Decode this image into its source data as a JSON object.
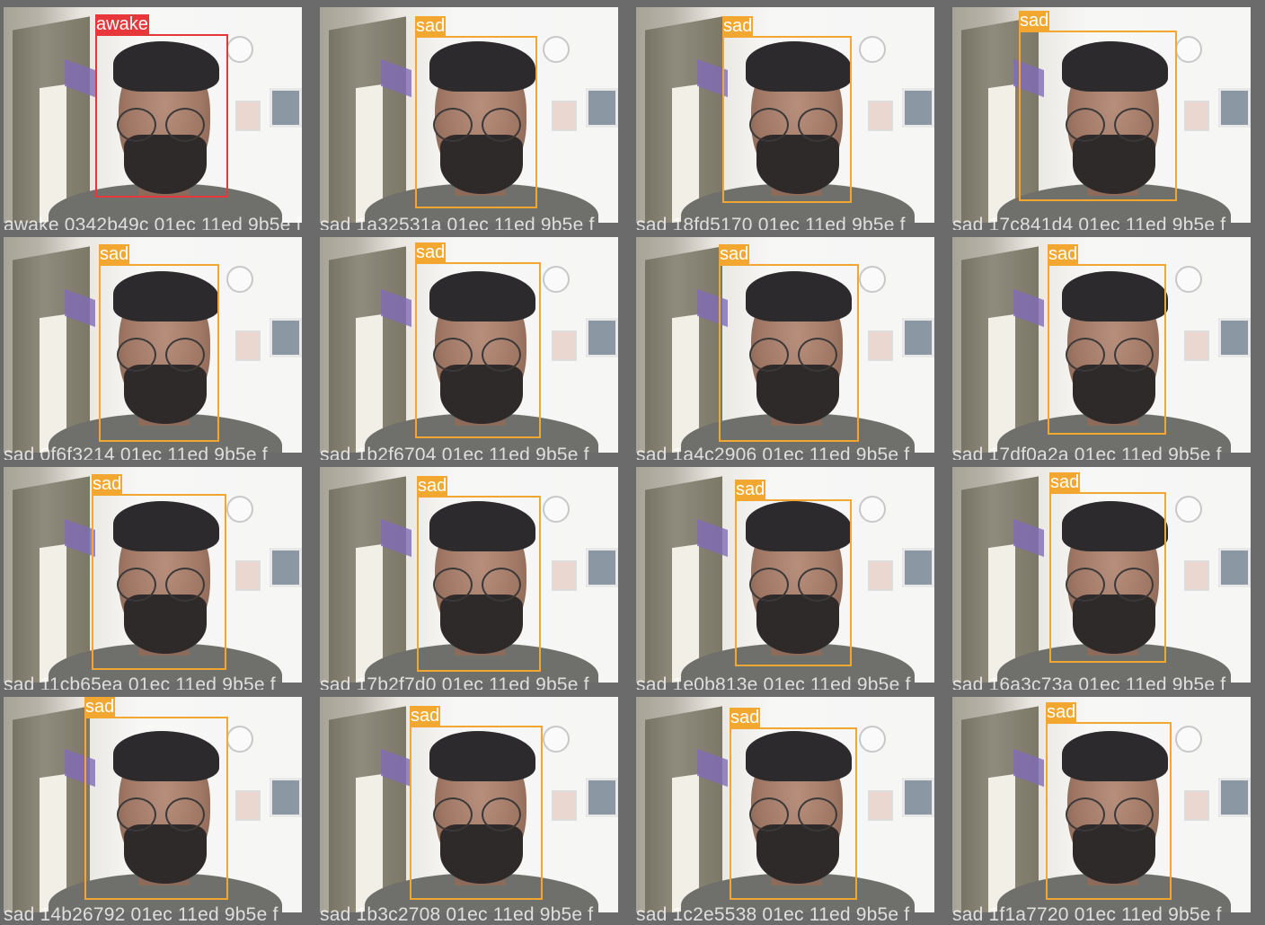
{
  "colors": {
    "awake": "#e8373b",
    "sad": "#f2a830"
  },
  "tiles": [
    {
      "label": "awake",
      "caption": "awake 0342b49c 01ec 11ed 9b5e f"
    },
    {
      "label": "sad",
      "caption": "sad 1a32531a 01ec 11ed 9b5e f"
    },
    {
      "label": "sad",
      "caption": "sad 18fd5170 01ec 11ed 9b5e f"
    },
    {
      "label": "sad",
      "caption": "sad 17c841d4 01ec 11ed 9b5e f"
    },
    {
      "label": "sad",
      "caption": "sad 0f6f3214 01ec 11ed 9b5e f"
    },
    {
      "label": "sad",
      "caption": "sad 1b2f6704 01ec 11ed 9b5e f"
    },
    {
      "label": "sad",
      "caption": "sad 1a4c2906 01ec 11ed 9b5e f"
    },
    {
      "label": "sad",
      "caption": "sad 17df0a2a 01ec 11ed 9b5e f"
    },
    {
      "label": "sad",
      "caption": "sad 11cb65ea 01ec 11ed 9b5e f"
    },
    {
      "label": "sad",
      "caption": "sad 17b2f7d0 01ec 11ed 9b5e f"
    },
    {
      "label": "sad",
      "caption": "sad 1e0b813e 01ec 11ed 9b5e f"
    },
    {
      "label": "sad",
      "caption": "sad 16a3c73a 01ec 11ed 9b5e f"
    },
    {
      "label": "sad",
      "caption": "sad 14b26792 01ec 11ed 9b5e f"
    },
    {
      "label": "sad",
      "caption": "sad 1b3c2708 01ec 11ed 9b5e f"
    },
    {
      "label": "sad",
      "caption": "sad 1c2e5538 01ec 11ed 9b5e f"
    },
    {
      "label": "sad",
      "caption": "sad 1f1a7720 01ec 11ed 9b5e f"
    }
  ]
}
